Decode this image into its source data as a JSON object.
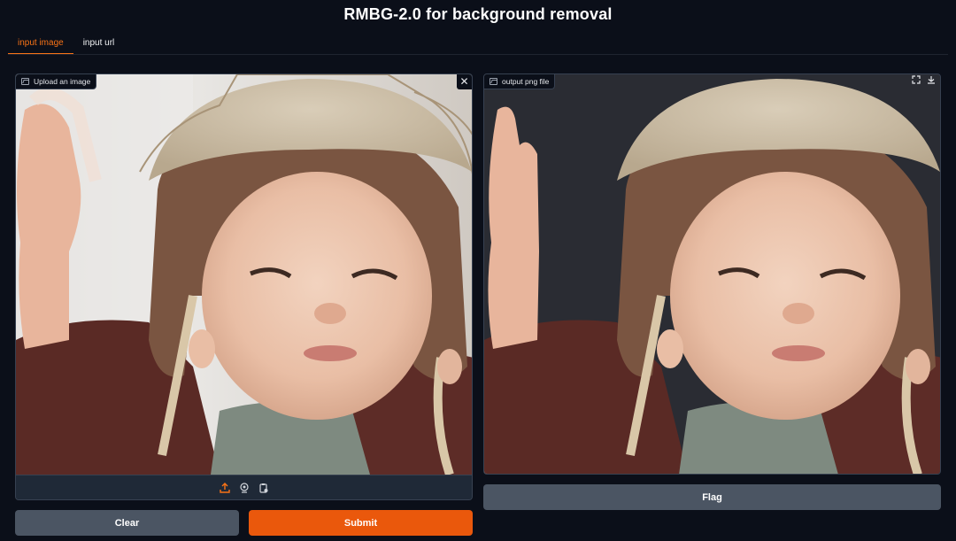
{
  "title": "RMBG-2.0 for background removal",
  "tabs": [
    {
      "label": "input image",
      "active": true
    },
    {
      "label": "input url",
      "active": false
    }
  ],
  "input_panel": {
    "label": "Upload an image",
    "close_icon": "close-icon",
    "source_icons": [
      "upload-icon",
      "webcam-icon",
      "clipboard-icon"
    ]
  },
  "output_panel": {
    "label": "output png file",
    "tool_icons": [
      "fullscreen-icon",
      "download-icon"
    ]
  },
  "buttons": {
    "clear": "Clear",
    "submit": "Submit",
    "flag": "Flag"
  },
  "colors": {
    "background": "#0b0f19",
    "accent": "#ea580c",
    "secondary_button": "#4b5563"
  }
}
